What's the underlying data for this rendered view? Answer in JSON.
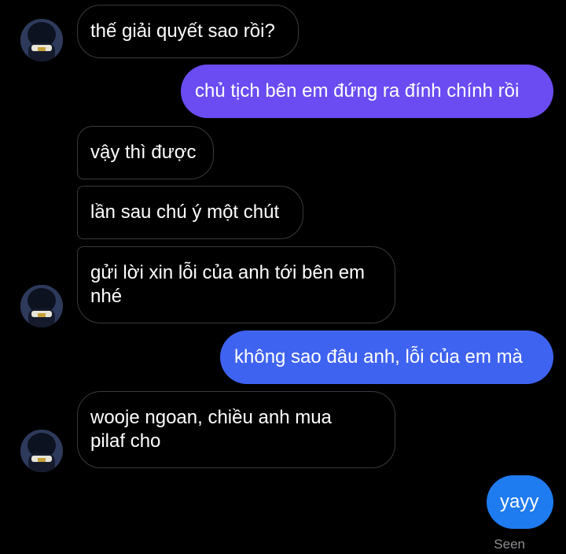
{
  "colors": {
    "background": "#000000",
    "incoming_border": "#3a3a3c",
    "outgoing_purple": "#6a4cf2",
    "outgoing_blue_purple": "#4f58f0",
    "outgoing_blue": "#2f6cf2",
    "outgoing_bright_blue": "#1f7bf0",
    "seen_text": "#8e8e93"
  },
  "avatar": {
    "icon": "user-avatar-icon"
  },
  "messages": [
    {
      "direction": "incoming",
      "text": "thế giải quyết sao rồi?"
    },
    {
      "direction": "outgoing",
      "text": "chủ tịch bên em đứng ra đính chính rồi"
    },
    {
      "direction": "incoming",
      "text": "vậy thì được"
    },
    {
      "direction": "incoming",
      "text": "lần sau chú ý một chút"
    },
    {
      "direction": "incoming",
      "text": "gửi lời xin lỗi của anh tới bên em\nnhé"
    },
    {
      "direction": "outgoing",
      "text": "không sao đâu anh, lỗi của em mà"
    },
    {
      "direction": "incoming",
      "text": "wooje ngoan, chiều anh mua\npilaf cho"
    },
    {
      "direction": "outgoing",
      "text": "yayy"
    }
  ],
  "status": {
    "seen_label": "Seen"
  }
}
